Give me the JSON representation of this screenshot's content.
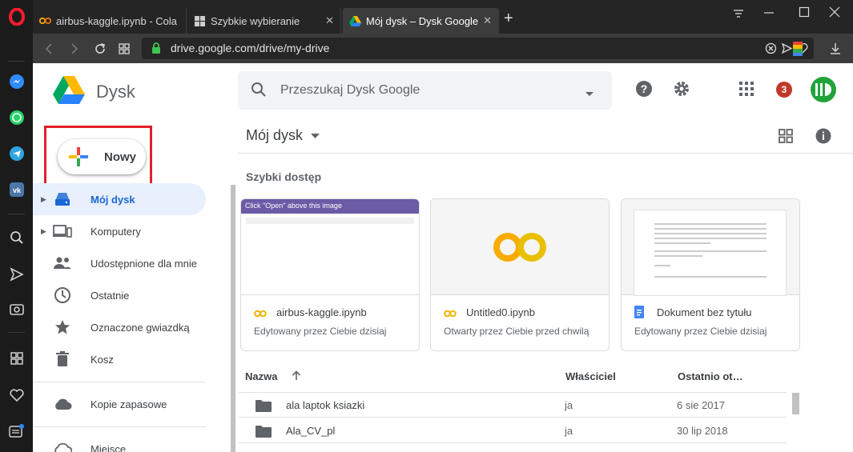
{
  "browser": {
    "tabs": [
      {
        "label": "airbus-kaggle.ipynb - Cola"
      },
      {
        "label": "Szybkie wybieranie"
      },
      {
        "label": "Mój dysk – Dysk Google"
      }
    ],
    "url": "drive.google.com/drive/my-drive"
  },
  "drive": {
    "app_name": "Dysk",
    "search_placeholder": "Przeszukaj Dysk Google",
    "notification_count": "3",
    "new_button": "Nowy",
    "nav": [
      {
        "label": "Mój dysk"
      },
      {
        "label": "Komputery"
      },
      {
        "label": "Udostępnione dla mnie"
      },
      {
        "label": "Ostatnie"
      },
      {
        "label": "Oznaczone gwiazdką"
      },
      {
        "label": "Kosz"
      },
      {
        "label": "Kopie zapasowe"
      },
      {
        "label": "Miejsce"
      }
    ],
    "breadcrumb": "Mój dysk",
    "quick_access_title": "Szybki dostęp",
    "quick_access": [
      {
        "name": "airbus-kaggle.ipynb",
        "subtitle": "Edytowany przez Ciebie dzisiaj",
        "thumb_banner": "Click \"Open\" above this image"
      },
      {
        "name": "Untitled0.ipynb",
        "subtitle": "Otwarty przez Ciebie przed chwilą"
      },
      {
        "name": "Dokument bez tytułu",
        "subtitle": "Edytowany przez Ciebie dzisiaj"
      }
    ],
    "columns": {
      "name": "Nazwa",
      "owner": "Właściciel",
      "modified": "Ostatnio ot…"
    },
    "files": [
      {
        "name": "ala laptok ksiazki",
        "owner": "ja",
        "modified": "6 sie 2017"
      },
      {
        "name": "Ala_CV_pl",
        "owner": "ja",
        "modified": "30 lip 2018"
      }
    ]
  },
  "colors": {
    "accent": "#1967d2",
    "highlight_frame": "#e0202c",
    "avatar": "#22a33a",
    "badge": "#c0392b"
  }
}
